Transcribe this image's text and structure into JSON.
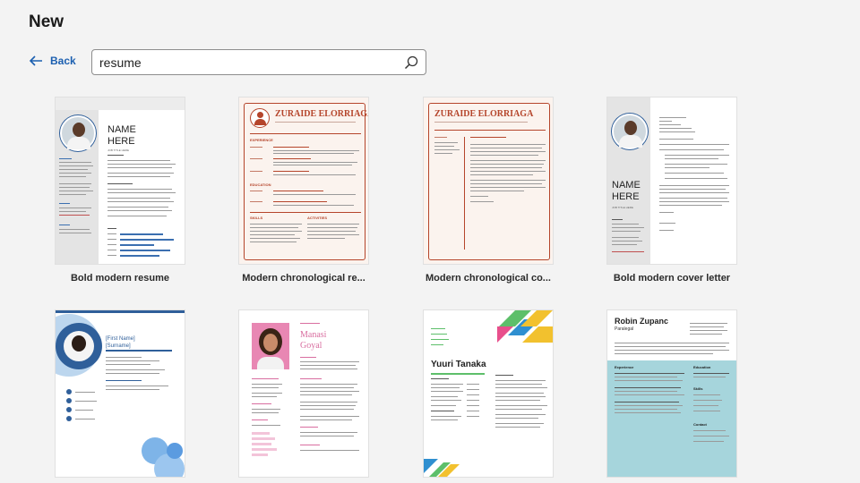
{
  "header": {
    "title": "New"
  },
  "nav": {
    "back_label": "Back"
  },
  "search": {
    "value": "resume"
  },
  "templates": [
    {
      "label": "Bold modern resume",
      "thumb": {
        "name": "NAME HERE",
        "subtitle": "JOB TITLE HERE"
      }
    },
    {
      "label": "Modern chronological re...",
      "thumb": {
        "name": "ZURAIDE ELORRIAGA",
        "sections": [
          "EXPERIENCE",
          "EDUCATION",
          "SKILLS",
          "ACTIVITIES"
        ]
      }
    },
    {
      "label": "Modern chronological co...",
      "thumb": {
        "name": "ZURAIDE ELORRIAGA"
      }
    },
    {
      "label": "Bold modern cover letter",
      "thumb": {
        "name": "NAME HERE",
        "subtitle": "JOB TITLE HERE"
      }
    },
    {
      "label": "",
      "thumb": {
        "name": "[First Name] [Surname]"
      }
    },
    {
      "label": "",
      "thumb": {
        "name": "Manasi Goyal"
      }
    },
    {
      "label": "",
      "thumb": {
        "name": "Yuuri Tanaka"
      }
    },
    {
      "label": "",
      "thumb": {
        "name": "Robin Zupanc",
        "subtitle": "Paralegal",
        "sections": [
          "Experience",
          "Education",
          "Skills",
          "Contact"
        ]
      }
    }
  ],
  "colors": {
    "accent": "#1b5fb0",
    "rust": "#b5452b",
    "blue": "#3b6fb0",
    "teal": "#a6d5dc",
    "pink": "#d96ea0"
  }
}
